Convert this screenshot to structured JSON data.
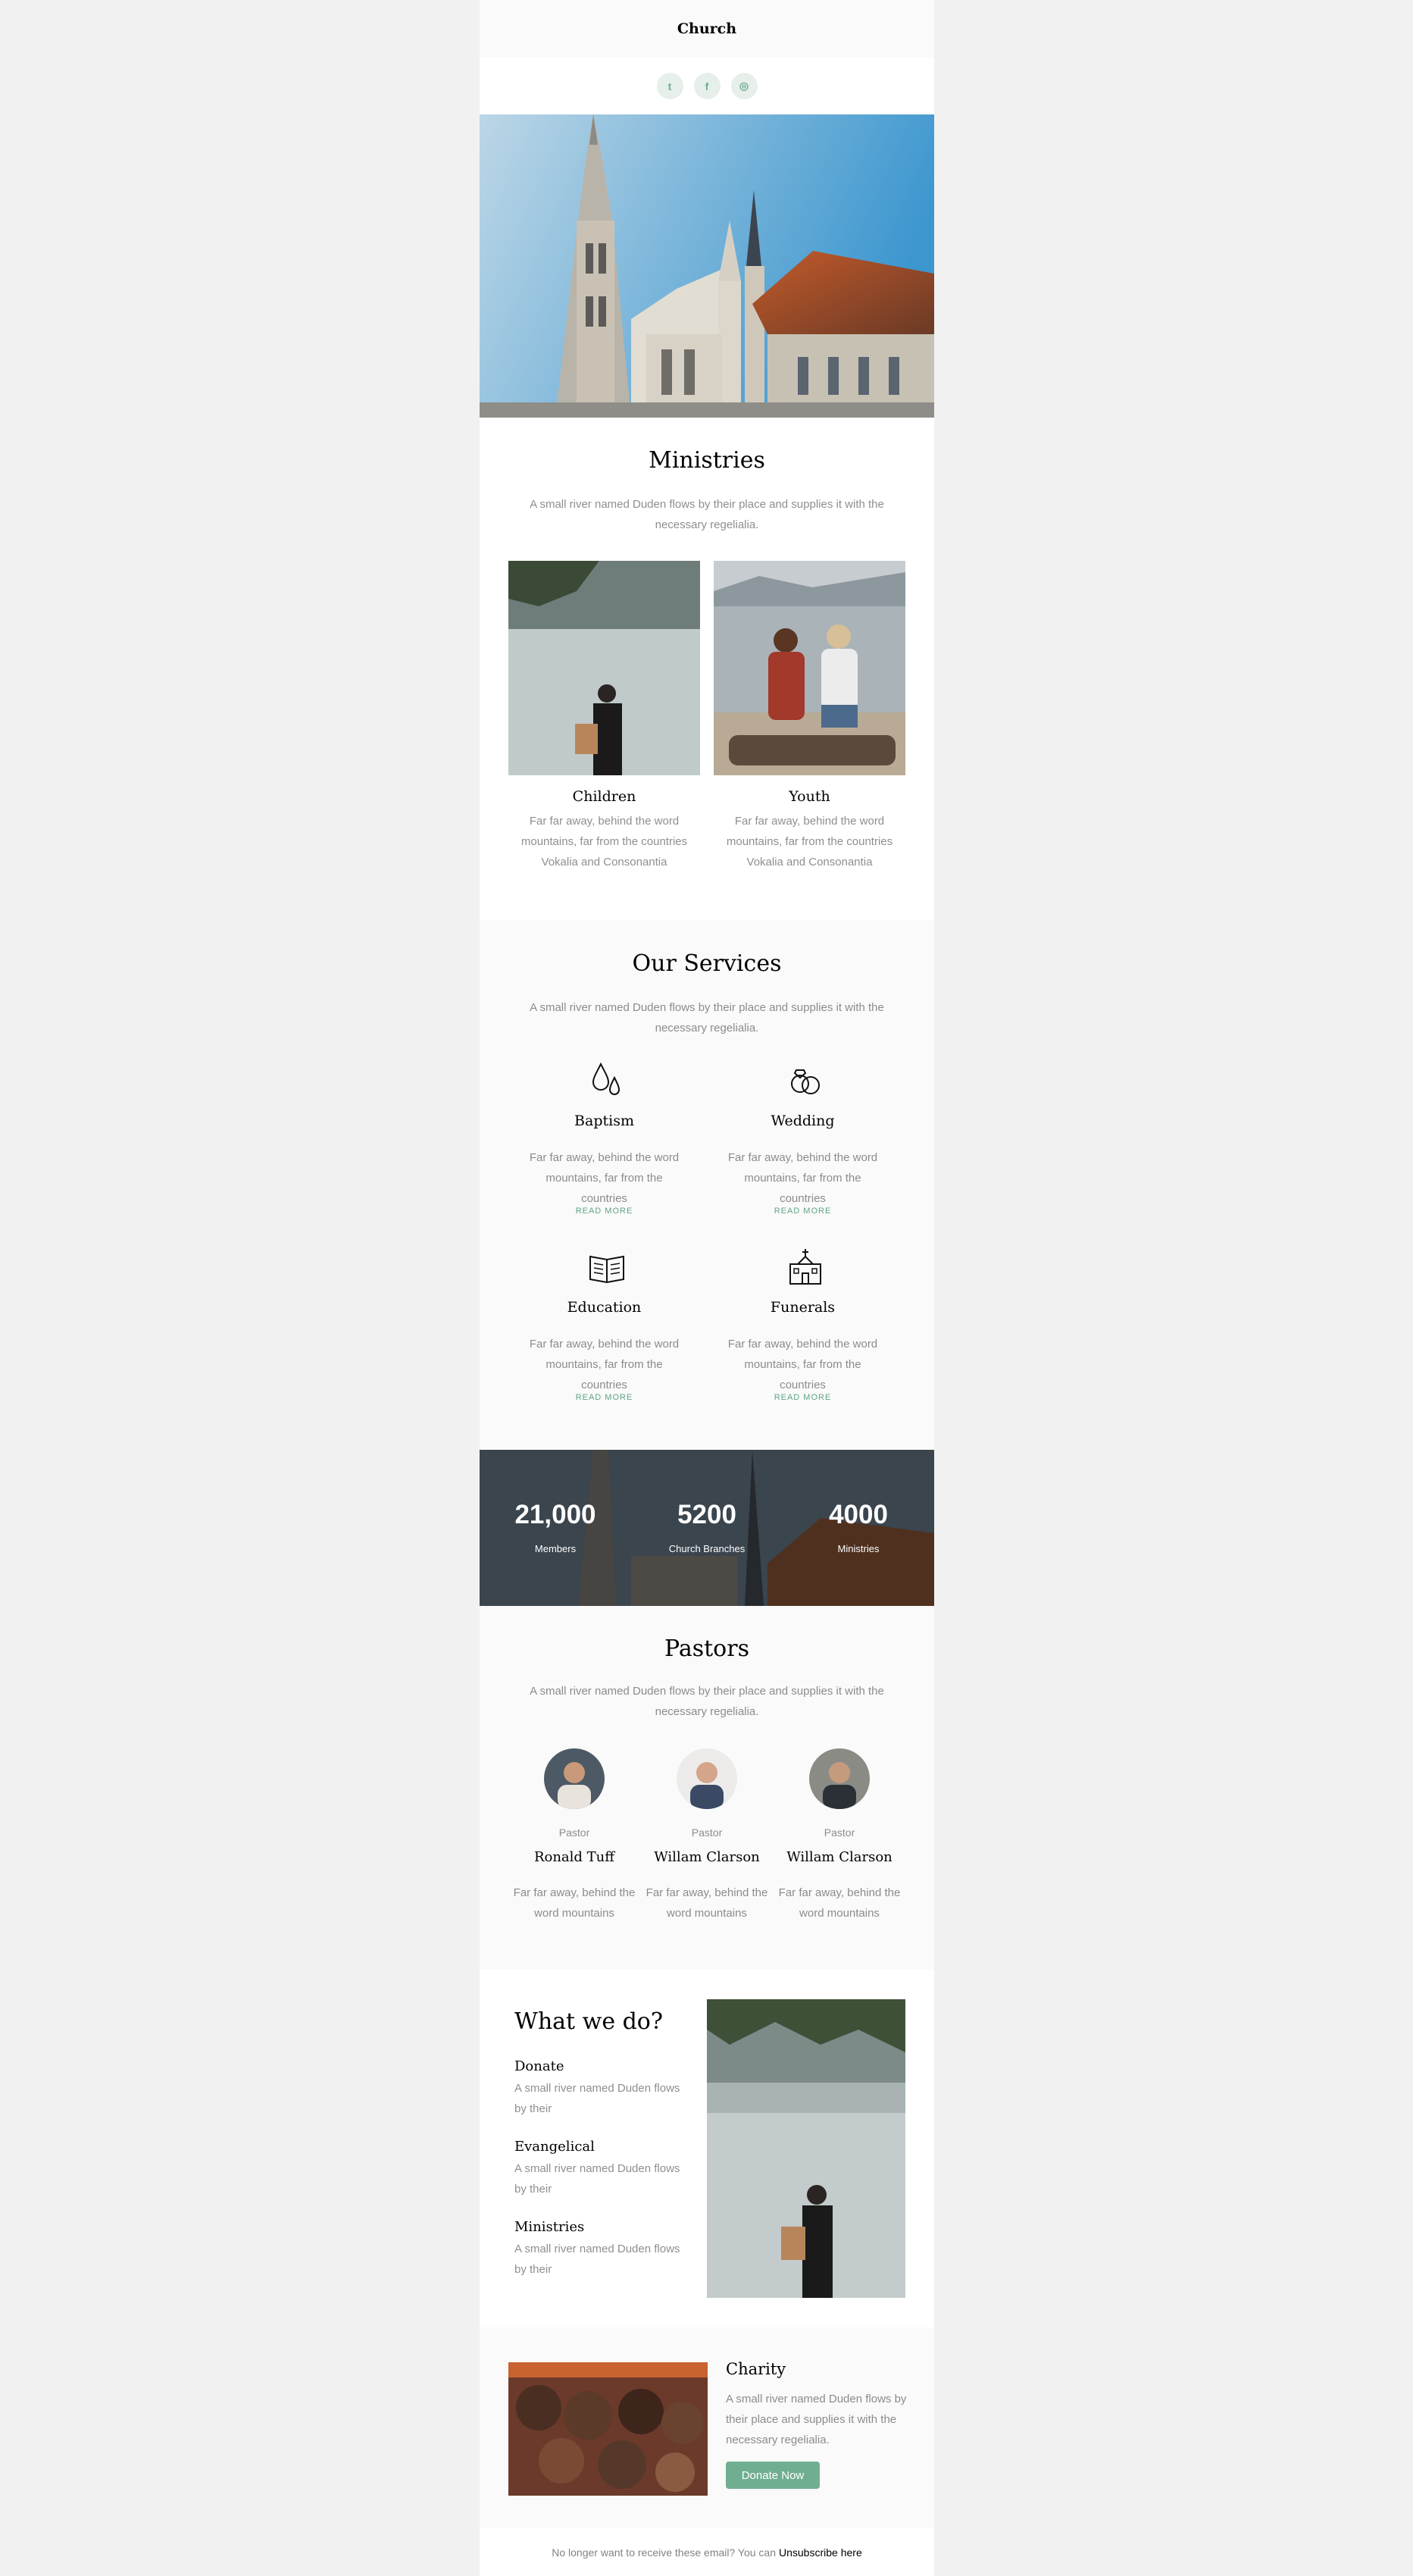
{
  "header": {
    "logo": "Church"
  },
  "social": [
    {
      "icon": "twitter-icon",
      "glyph": "t"
    },
    {
      "icon": "facebook-icon",
      "glyph": "f"
    },
    {
      "icon": "instagram-icon",
      "glyph": "◎"
    }
  ],
  "ministries": {
    "title": "Ministries",
    "subtitle": "A small river named Duden flows by their place and supplies it with the necessary regelialia.",
    "cards": [
      {
        "title": "Children",
        "text": "Far far away, behind the word mountains, far from the countries Vokalia and Consonantia"
      },
      {
        "title": "Youth",
        "text": "Far far away, behind the word mountains, far from the countries Vokalia and Consonantia"
      }
    ]
  },
  "services": {
    "title": "Our Services",
    "subtitle": "A small river named Duden flows by their place and supplies it with the necessary regelialia.",
    "read_more": "READ MORE",
    "items": [
      {
        "title": "Baptism",
        "text": "Far far away, behind the word mountains, far from the countries",
        "icon": "water-drops-icon"
      },
      {
        "title": "Wedding",
        "text": "Far far away, behind the word mountains, far from the countries",
        "icon": "wedding-rings-icon"
      },
      {
        "title": "Education",
        "text": "Far far away, behind the word mountains, far from the countries",
        "icon": "open-book-icon"
      },
      {
        "title": "Funerals",
        "text": "Far far away, behind the word mountains, far from the countries",
        "icon": "church-building-icon"
      }
    ]
  },
  "stats": [
    {
      "value": "21,000",
      "label": "Members"
    },
    {
      "value": "5200",
      "label": "Church Branches"
    },
    {
      "value": "4000",
      "label": "Ministries"
    }
  ],
  "pastors": {
    "title": "Pastors",
    "subtitle": "A small river named Duden flows by their place and supplies it with the necessary regelialia.",
    "people": [
      {
        "role": "Pastor",
        "name": "Ronald Tuff",
        "text": "Far far away, behind the word mountains"
      },
      {
        "role": "Pastor",
        "name": "Willam Clarson",
        "text": "Far far away, behind the word mountains"
      },
      {
        "role": "Pastor",
        "name": "Willam Clarson",
        "text": "Far far away, behind the word mountains"
      }
    ]
  },
  "whatwedo": {
    "title": "What we do?",
    "items": [
      {
        "title": "Donate",
        "text": "A small river named Duden flows by their"
      },
      {
        "title": "Evangelical",
        "text": "A small river named Duden flows by their"
      },
      {
        "title": "Ministries",
        "text": "A small river named Duden flows by their"
      }
    ]
  },
  "charity": {
    "title": "Charity",
    "text": "A small river named Duden flows by their place and supplies it with the necessary regelialia.",
    "button": "Donate Now"
  },
  "footer": {
    "text": "No longer want to receive these email? You can",
    "link": "Unsubscribe here"
  },
  "colors": {
    "accent": "#6fae91",
    "page_bg": "#f1f1f1",
    "section_bg": "#fafafa"
  }
}
